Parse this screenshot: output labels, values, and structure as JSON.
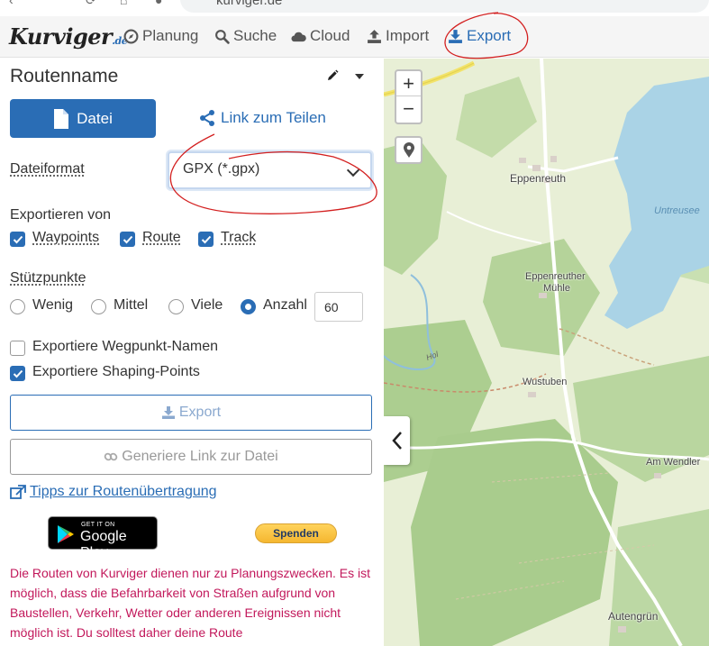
{
  "browser": {
    "url": "kurviger.de"
  },
  "navbar": {
    "logo_main": "Kurviger",
    "logo_suffix": ".de",
    "items": [
      {
        "label": "Planung",
        "icon": "compass-icon"
      },
      {
        "label": "Suche",
        "icon": "search-icon"
      },
      {
        "label": "Cloud",
        "icon": "cloud-icon"
      },
      {
        "label": "Import",
        "icon": "upload-icon"
      },
      {
        "label": "Export",
        "icon": "download-icon",
        "active": true
      }
    ]
  },
  "panel": {
    "route_name": "Routenname",
    "file_button": "Datei",
    "share_link": "Link zum Teilen",
    "format_label": "Dateiformat",
    "format_value": "GPX (*.gpx)",
    "export_from_label": "Exportieren von",
    "export_from": [
      {
        "label": "Waypoints",
        "checked": true
      },
      {
        "label": "Route",
        "checked": true
      },
      {
        "label": "Track",
        "checked": true
      }
    ],
    "support_points_label": "Stützpunkte",
    "support_points_options": [
      {
        "label": "Wenig",
        "selected": false
      },
      {
        "label": "Mittel",
        "selected": false
      },
      {
        "label": "Viele",
        "selected": false
      },
      {
        "label": "Anzahl",
        "selected": true
      }
    ],
    "support_points_count": "60",
    "options": [
      {
        "label": "Exportiere Wegpunkt-Namen",
        "checked": false
      },
      {
        "label": "Exportiere Shaping-Points",
        "checked": true
      }
    ],
    "export_button": "Export",
    "generate_link_button": "Generiere Link zur Datei",
    "tips_link": "Tipps zur Routenübertragung",
    "google_play_small": "GET IT ON",
    "google_play_big": "Google Play",
    "donate_button": "Spenden",
    "disclaimer": "Die Routen von Kurviger dienen nur zu Planungszwecken. Es ist möglich, dass die Befahrbarkeit von Straßen aufgrund von Baustellen, Verkehr, Wetter oder anderen Ereignissen nicht möglich ist. Du solltest daher deine Route"
  },
  "map": {
    "zoom_in": "+",
    "zoom_out": "−",
    "places": [
      "Eppenreuth",
      "Eppenreuther",
      "Mühle",
      "Wustuben",
      "Am Wendler",
      "Autengrün"
    ],
    "water_label": "Untreusee",
    "stream_label": "Hol"
  },
  "colors": {
    "accent": "#2a6db5",
    "disclaimer": "#c2185b",
    "annotation": "#d32020"
  }
}
